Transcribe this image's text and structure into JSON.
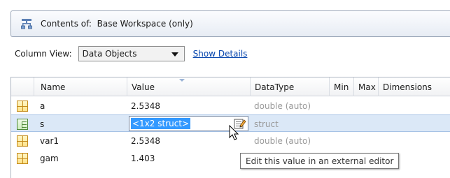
{
  "contents_bar": {
    "label": "Contents of:",
    "workspace": "Base Workspace (only)"
  },
  "view": {
    "label": "Column View:",
    "selected": "Data Objects",
    "show_details": "Show Details"
  },
  "table": {
    "columns": [
      "Name",
      "Value",
      "DataType",
      "Min",
      "Max",
      "Dimensions"
    ],
    "rows": [
      {
        "icon": "matrix-icon",
        "name": "a",
        "value": "2.5348",
        "datatype": "double (auto)"
      },
      {
        "icon": "struct-icon",
        "name": "s",
        "value": "<1x2 struct>",
        "datatype": "struct",
        "selected": true
      },
      {
        "icon": "matrix-icon",
        "name": "var1",
        "value": "2.5348",
        "datatype": "double (auto)"
      },
      {
        "icon": "matrix-icon",
        "name": "gam",
        "value": "1.403",
        "datatype": "double (auto)"
      }
    ]
  },
  "tooltip": "Edit this value in an external editor"
}
